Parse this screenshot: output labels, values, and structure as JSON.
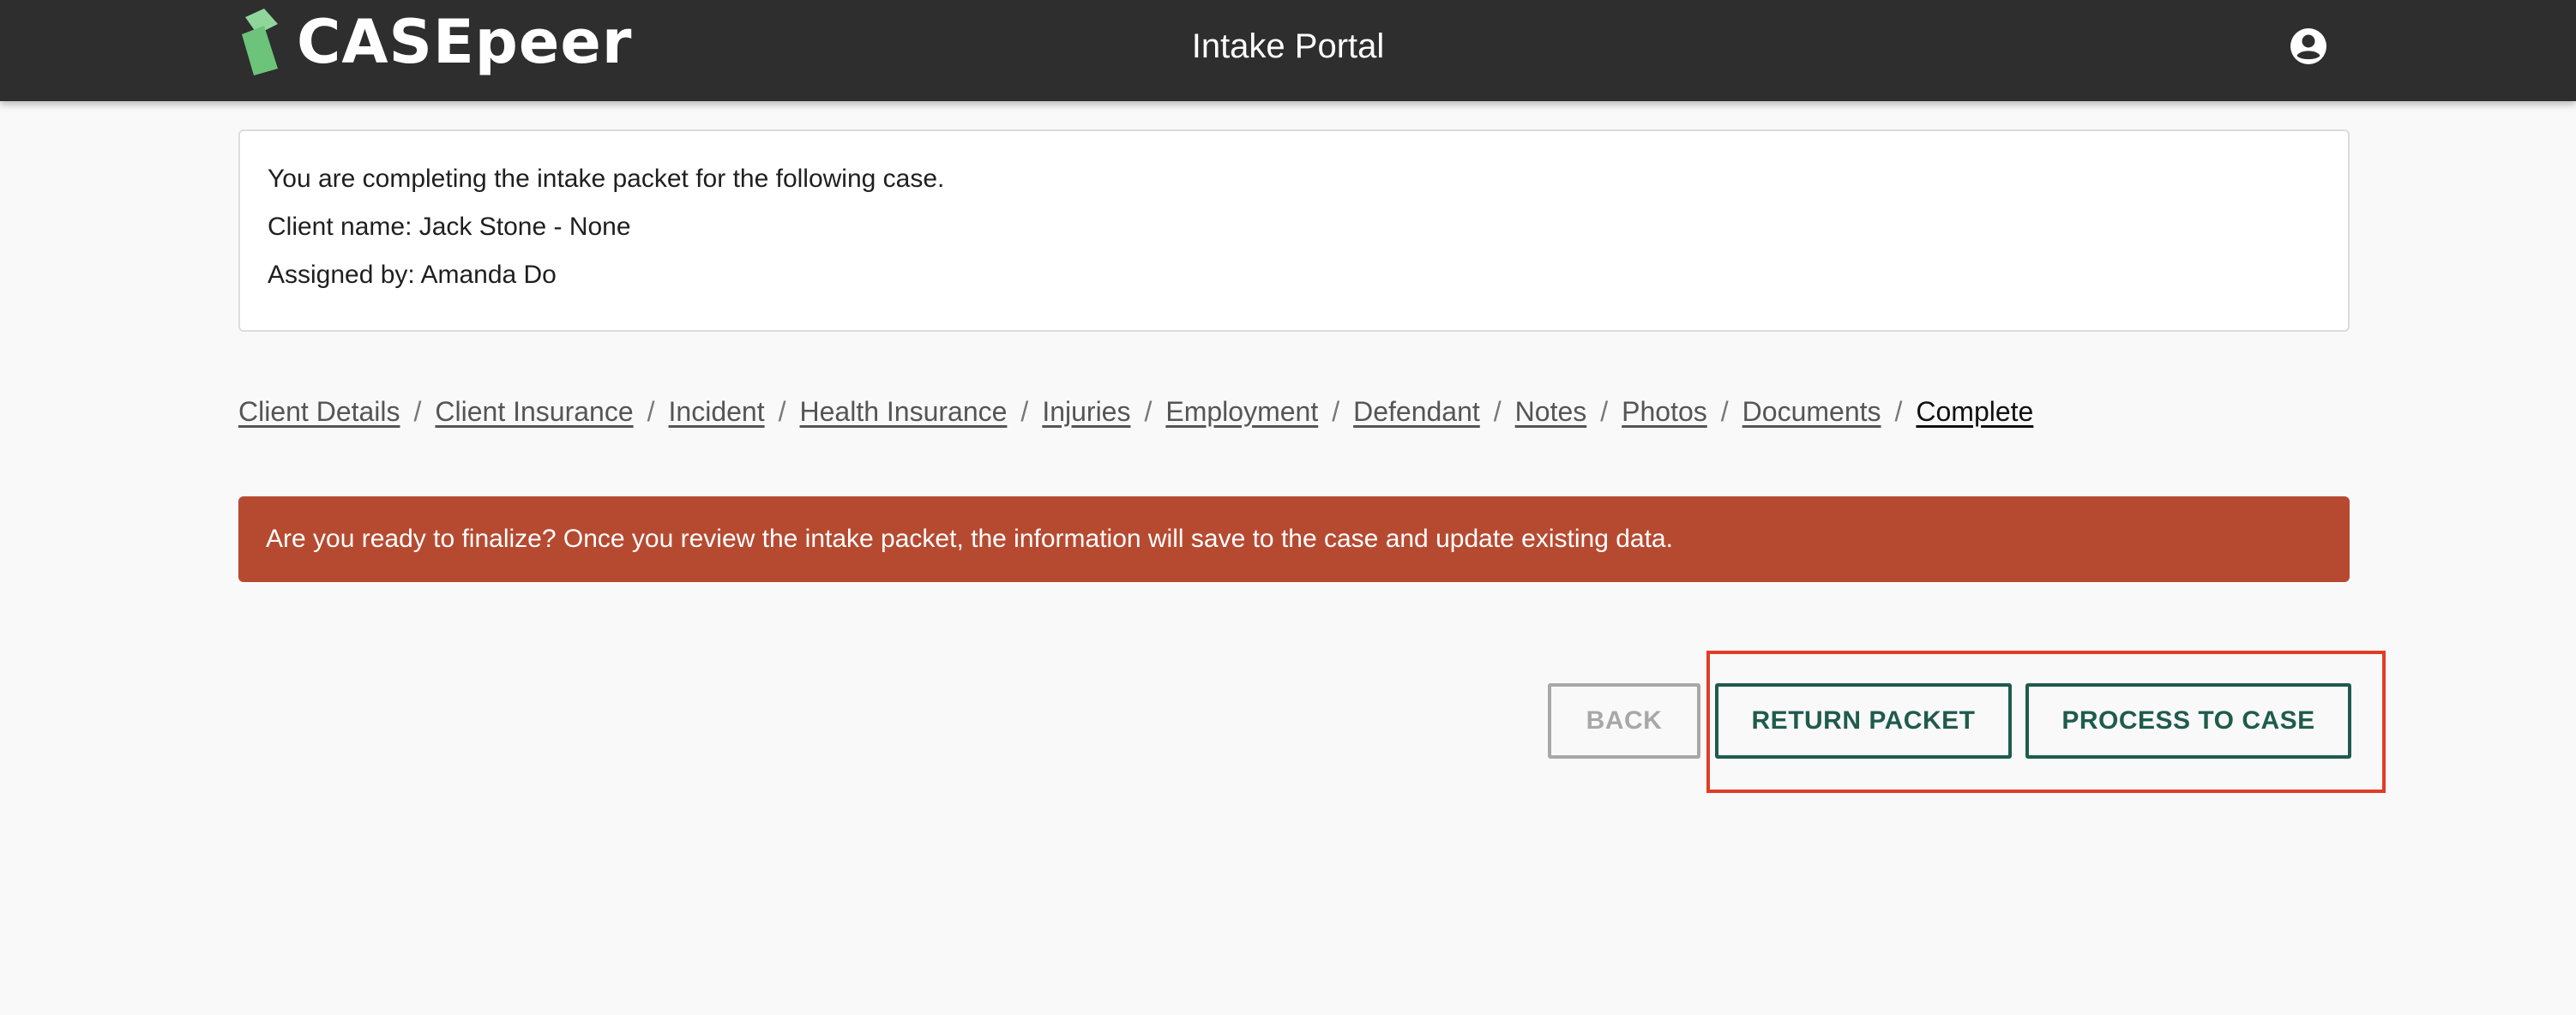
{
  "header": {
    "logo_text": "CASEpeer",
    "title": "Intake Portal",
    "logo_color": "#6cc47a",
    "background": "#2e2e2e"
  },
  "case_info": {
    "intro": "You are completing the intake packet for the following case.",
    "client_name": "Client name: Jack Stone - None",
    "assigned_by": "Assigned by: Amanda Do"
  },
  "breadcrumb": {
    "separator": "/",
    "items": [
      {
        "label": "Client Details"
      },
      {
        "label": "Client Insurance"
      },
      {
        "label": "Incident"
      },
      {
        "label": "Health Insurance"
      },
      {
        "label": "Injuries"
      },
      {
        "label": "Employment"
      },
      {
        "label": "Defendant"
      },
      {
        "label": "Notes"
      },
      {
        "label": "Photos"
      },
      {
        "label": "Documents"
      },
      {
        "label": "Complete"
      }
    ],
    "current": "Complete"
  },
  "alert": {
    "message": "Are you ready to finalize? Once you review the intake packet, the information will save to the case and update existing data.",
    "color": "#b64a31"
  },
  "actions": {
    "back_label": "BACK",
    "return_label": "RETURN PACKET",
    "process_label": "PROCESS TO CASE",
    "accent": "#1f5b4d",
    "highlight_color": "#e23c26"
  }
}
